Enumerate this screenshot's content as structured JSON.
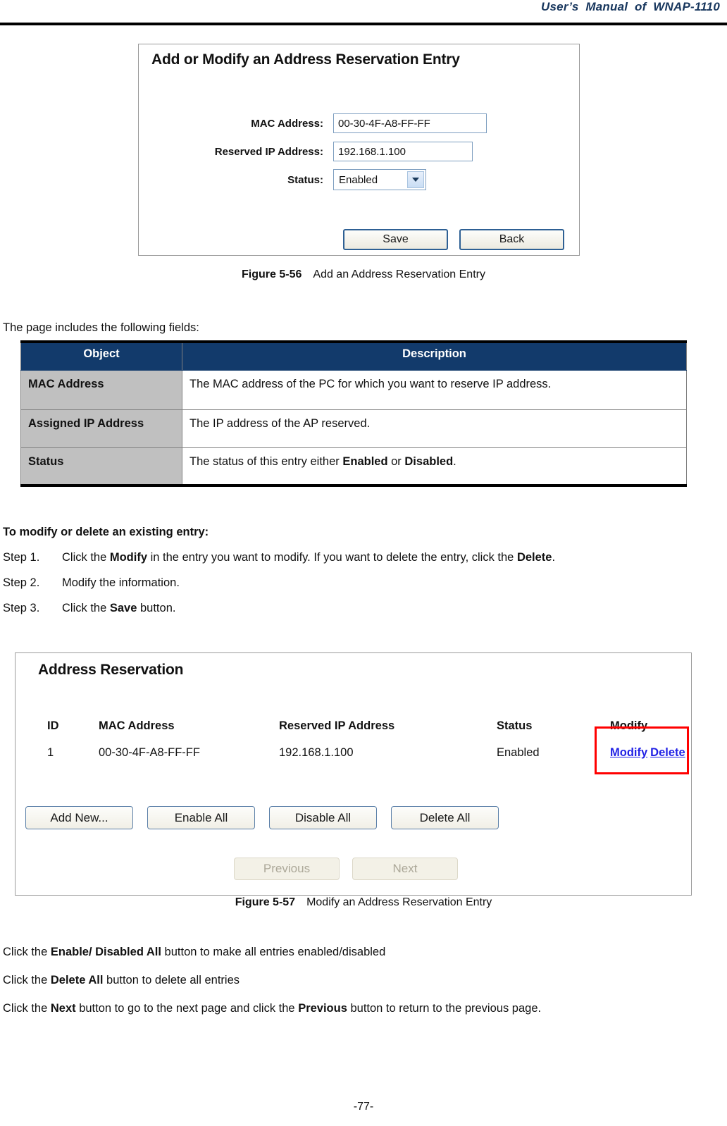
{
  "header": {
    "manual_title": "User’s  Manual  of  WNAP-1110"
  },
  "figure1": {
    "panel_title": "Add or Modify an Address Reservation Entry",
    "fields": [
      {
        "label": "MAC Address:",
        "value": "00-30-4F-A8-FF-FF",
        "type": "text"
      },
      {
        "label": "Reserved IP Address:",
        "value": "192.168.1.100",
        "type": "text"
      },
      {
        "label": "Status:",
        "value": "Enabled",
        "type": "select"
      }
    ],
    "buttons": {
      "save": "Save",
      "back": "Back"
    },
    "caption_number": "Figure 5-56",
    "caption_text": "Add an Address Reservation Entry"
  },
  "intro": {
    "fields_lead": "The page includes the following fields:"
  },
  "desc_table": {
    "headers": [
      "Object",
      "Description"
    ],
    "rows": [
      {
        "object": "MAC Address",
        "description_plain": "The MAC address of the PC for which you want to reserve IP address.",
        "description_pre": "The MAC address of the PC for which you want to reserve IP address.",
        "description_bold1": "",
        "description_mid": "",
        "description_bold2": "",
        "description_post": ""
      },
      {
        "object": "Assigned IP Address",
        "description_plain": "The IP address of the AP reserved.",
        "description_pre": "The IP address of the AP reserved.",
        "description_bold1": "",
        "description_mid": "",
        "description_bold2": "",
        "description_post": ""
      },
      {
        "object": "Status",
        "description_plain": "The status of this entry either Enabled or Disabled.",
        "description_pre": "The status of this entry either ",
        "description_bold1": "Enabled",
        "description_mid": " or ",
        "description_bold2": "Disabled",
        "description_post": "."
      }
    ]
  },
  "modify_section": {
    "heading": "To modify or delete an existing entry:",
    "steps": [
      {
        "label": "Step 1.",
        "pre": "Click the ",
        "bold1": "Modify",
        "mid": " in the entry you want to modify. If you want to delete the entry, click the ",
        "bold2": "Delete",
        "post": "."
      },
      {
        "label": "Step 2.",
        "pre": "Modify the information.",
        "bold1": "",
        "mid": "",
        "bold2": "",
        "post": ""
      },
      {
        "label": "Step 3.",
        "pre": "Click the ",
        "bold1": "Save",
        "mid": " button.",
        "bold2": "",
        "post": ""
      }
    ]
  },
  "figure2": {
    "panel_title": "Address Reservation",
    "columns": [
      "ID",
      "MAC Address",
      "Reserved IP Address",
      "Status",
      "Modify"
    ],
    "rows": [
      {
        "id": "1",
        "mac": "00-30-4F-A8-FF-FF",
        "ip": "192.168.1.100",
        "status": "Enabled",
        "modify_link": "Modify",
        "delete_link": "Delete"
      }
    ],
    "buttons": {
      "add_new": "Add New...",
      "enable_all": "Enable All",
      "disable_all": "Disable All",
      "delete_all": "Delete All"
    },
    "pager": {
      "previous": "Previous",
      "next": "Next"
    },
    "highlight_color": "#FF0000",
    "link_color": "#2121E5",
    "caption_number": "Figure 5-57",
    "caption_text": "Modify an Address Reservation Entry"
  },
  "closing_notes": [
    {
      "pre": "Click the ",
      "bold1": "Enable/ Disabled All",
      "mid": " button to make all entries enabled/disabled",
      "bold2": "",
      "post": ""
    },
    {
      "pre": "Click the ",
      "bold1": "Delete All",
      "mid": " button to delete all entries",
      "bold2": "",
      "post": ""
    },
    {
      "pre": "Click the ",
      "bold1": "Next",
      "mid": " button to go to the next page and click the ",
      "bold2": "Previous",
      "post": " button to return to the previous page."
    }
  ],
  "footer": {
    "page_number": "-77-"
  }
}
